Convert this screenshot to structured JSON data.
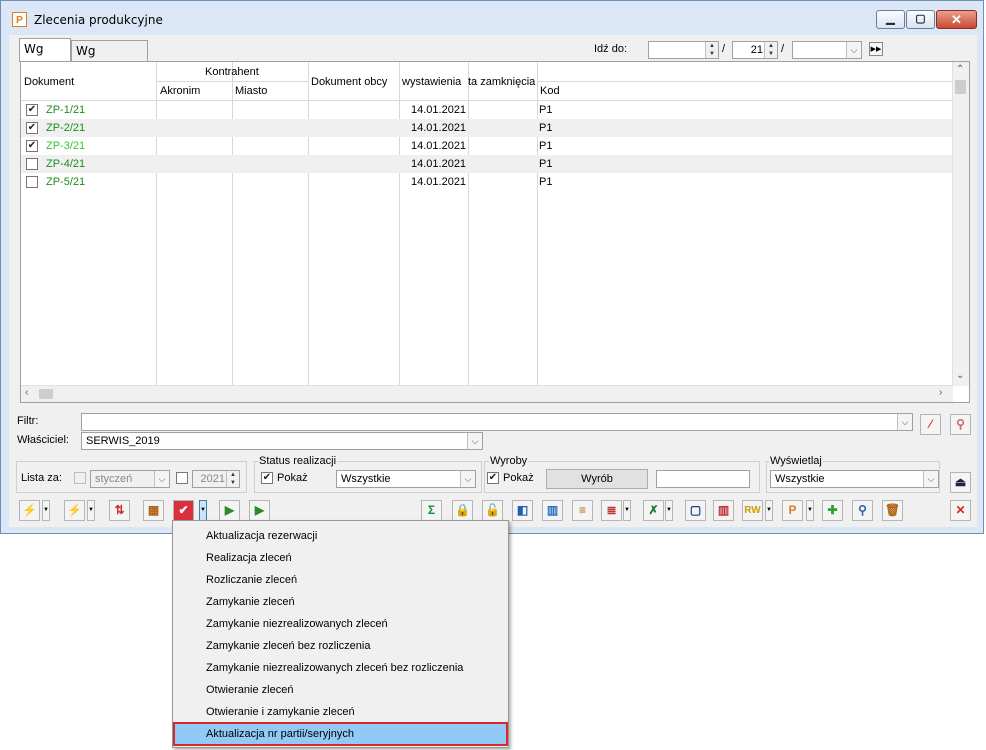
{
  "window": {
    "title": "Zlecenia produkcyjne",
    "icon": "app-p-icon"
  },
  "tabs": [
    {
      "label": "Wg daty",
      "active": true
    },
    {
      "label": "Wg operatora",
      "active": false
    }
  ],
  "goto": {
    "label": "Idź do:",
    "day": "",
    "month": "21",
    "sep": "/",
    "year": ""
  },
  "grid": {
    "headers": {
      "dokument": "Dokument",
      "kontrahent": "Kontrahent",
      "akronim": "Akronim",
      "miasto": "Miasto",
      "dokument_obcy": "Dokument obcy",
      "wystawienia": "wystawienia",
      "zamkniecia": "ta zamknięcia",
      "kod": "Kod"
    },
    "rows": [
      {
        "checked": true,
        "doc": "ZP-1/21",
        "date": "14.01.2021",
        "kod": "P1"
      },
      {
        "checked": true,
        "doc": "ZP-2/21",
        "date": "14.01.2021",
        "kod": "P1"
      },
      {
        "checked": true,
        "doc": "ZP-3/21",
        "date": "14.01.2021",
        "kod": "P1"
      },
      {
        "checked": false,
        "doc": "ZP-4/21",
        "date": "14.01.2021",
        "kod": "P1"
      },
      {
        "checked": false,
        "doc": "ZP-5/21",
        "date": "14.01.2021",
        "kod": "P1"
      }
    ]
  },
  "filter": {
    "label": "Filtr:",
    "value": ""
  },
  "owner": {
    "label": "Właściciel:",
    "value": "SERWIS_2019"
  },
  "lista": {
    "label": "Lista za:",
    "month": "styczeń",
    "year": "2021"
  },
  "status": {
    "title": "Status realizacji",
    "show_label": "Pokaż",
    "value": "Wszystkie"
  },
  "wyroby": {
    "title": "Wyroby",
    "show_label": "Pokaż",
    "button": "Wyrób",
    "value": ""
  },
  "wyswietlaj": {
    "title": "Wyświetlaj",
    "value": "Wszystkie"
  },
  "menu": {
    "items": [
      "Aktualizacja rezerwacji",
      "Realizacja zleceń",
      "Rozliczanie zleceń",
      "Zamykanie zleceń",
      "Zamykanie niezrealizowanych zleceń",
      "Zamykanie zleceń bez rozliczenia",
      "Zamykanie niezrealizowanych zleceń bez rozliczenia",
      "Otwieranie zleceń",
      "Otwieranie i zamykanie zleceń",
      "Aktualizacja nr partii/seryjnych"
    ],
    "highlighted_index": 9
  },
  "icon_glyphs": {
    "lightning_orange": "⚡",
    "lightning_green": "⚡",
    "sort": "⇅",
    "calendar": "▦",
    "close_doc": "✔",
    "import": "▶",
    "export": "▶",
    "sum": "Σ",
    "lock": "🔒",
    "unlock": "🔓",
    "doc_blue": "◧",
    "chart": "▥",
    "list": "≡",
    "tree": "≣",
    "excel": "✗",
    "page": "▢",
    "books": "▥",
    "rw": "RW",
    "p": "P",
    "add": "✚",
    "search": "⚲",
    "trash": "🗑",
    "delete": "✕",
    "up": "⏏",
    "filter_clear": "⁄",
    "filter_wizard": "⚲"
  },
  "colors": {
    "doc_dark": "#1a8f1a",
    "doc_light": "#2ec92e",
    "highlight": "#91c9f7",
    "highlight_border": "#d42a2a"
  }
}
